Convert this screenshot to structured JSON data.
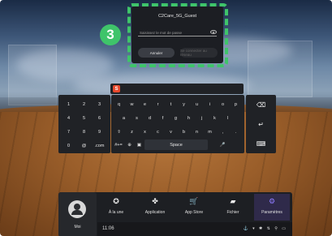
{
  "dialog": {
    "network_name": "C2Care_5G_Guest",
    "password_placeholder": "Saisissez le mot de passe",
    "cancel_label": "Annuler",
    "connect_label": "Se connecter au réseau",
    "step_number": "3",
    "highlight_color": "#3fc46a"
  },
  "keyboard": {
    "numpad": [
      [
        "1",
        "2",
        "3"
      ],
      [
        "4",
        "5",
        "6"
      ],
      [
        "7",
        "8",
        "9"
      ],
      [
        "0",
        "@",
        ".com"
      ]
    ],
    "rows": [
      [
        "q",
        "w",
        "e",
        "r",
        "t",
        "y",
        "u",
        "i",
        "o",
        "p"
      ],
      [
        "a",
        "s",
        "d",
        "f",
        "g",
        "h",
        "j",
        "k",
        "l"
      ],
      [
        "⇧",
        "z",
        "x",
        "c",
        "v",
        "b",
        "n",
        "m",
        ",",
        "."
      ]
    ],
    "bottom": {
      "sym_label": "#+=",
      "space_label": "Space"
    },
    "side_icons": [
      "backspace-icon",
      "enter-icon",
      "keyboard-hide-icon"
    ],
    "logo_letter": "S"
  },
  "dock": {
    "profile_label": "Moi",
    "apps": [
      {
        "label": "À la une",
        "icon": "compass-icon",
        "glyph": "✪"
      },
      {
        "label": "Application",
        "icon": "grid-icon",
        "glyph": "✤"
      },
      {
        "label": "App Store",
        "icon": "cart-icon",
        "glyph": "🛒"
      },
      {
        "label": "Fichier",
        "icon": "folder-icon",
        "glyph": "▰"
      },
      {
        "label": "Paramètres",
        "icon": "gear-icon",
        "glyph": "⚙"
      }
    ],
    "active_index": 4,
    "active_color": "#8f7cff",
    "clock": "11:06",
    "status_text": "⚓ ▾ ✱ ⇅ ⚲ ▭"
  }
}
